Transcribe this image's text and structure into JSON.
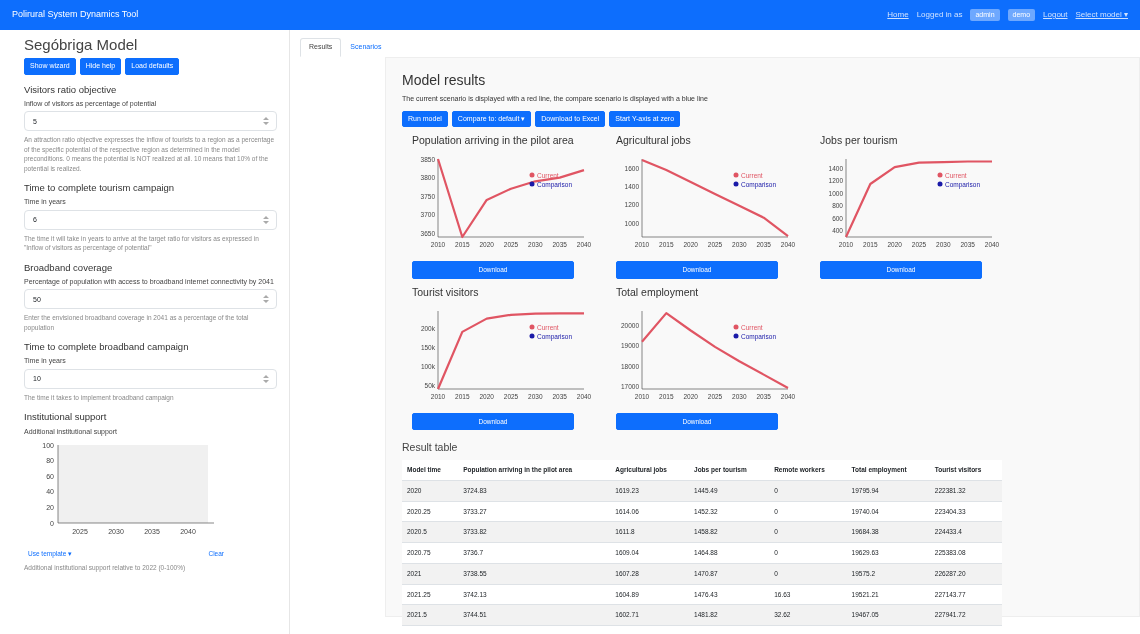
{
  "navbar": {
    "brand": "Polirural System Dynamics Tool",
    "links": [
      {
        "kind": "link",
        "label": "Home"
      },
      {
        "kind": "text",
        "label": "Logged in as"
      },
      {
        "kind": "badge",
        "label": "admin"
      },
      {
        "kind": "badge",
        "label": "demo"
      },
      {
        "kind": "link",
        "label": "Logout"
      },
      {
        "kind": "link",
        "label": "Select model ▾"
      }
    ]
  },
  "sidebar": {
    "title": "Segóbriga Model",
    "buttons": [
      "Show wizard",
      "Hide help",
      "Load defaults"
    ],
    "parameters": [
      {
        "kind": "input",
        "title": "Visitors ratio objective",
        "label": "Inflow of visitors as percentage of potential",
        "value": "5",
        "help": "An attraction ratio objective expresses the inflow of tourists to a region as a percentage of the specific potential of the respective region as determined in the model preconditions. 0 means the potential is NOT realized at all. 10 means that 10% of the potential is realized."
      },
      {
        "kind": "input",
        "title": "Time to complete tourism campaign",
        "label": "Time in years",
        "value": "6",
        "help": "The time it will take in years to arrive at the target ratio for visitors as expressed in \"Inflow of visitors as percentage of potential\""
      },
      {
        "kind": "input",
        "title": "Broadband coverage",
        "label": "Percentage of population with access to broadband internet connectivity by 2041",
        "value": "50",
        "help": "Enter the envisioned broadband coverage in 2041 as a percentage of the total population"
      },
      {
        "kind": "input",
        "title": "Time to complete broadband campaign",
        "label": "Time in years",
        "value": "10",
        "help": "The time it takes to implement broadband campaign"
      },
      {
        "kind": "graph",
        "title": "Institutional support",
        "label": "Additional institutional support",
        "y_ticks": [
          "100",
          "80",
          "60",
          "40",
          "20",
          "0"
        ],
        "x_ticks": [
          "2025",
          "2030",
          "2035",
          "2040"
        ],
        "template_link": "Use template ▾",
        "clear_link": "Clear",
        "help": "Additional institutional support relative to 2022 (0-100%)"
      }
    ]
  },
  "tabs": [
    {
      "label": "Results",
      "selected": true
    },
    {
      "label": "Scenarios",
      "selected": false
    }
  ],
  "results": {
    "title": "Model results",
    "description": "The current scenario is displayed with a red line, the compare scenario is displayed with a blue line",
    "buttons": [
      "Run model",
      "Compare to: default ▾",
      "Download to Excel",
      "Start Y-axis at zero"
    ],
    "charts": [
      {
        "download": "Download",
        "chart_data": {
          "type": "line",
          "title": "Population arriving in the pilot area",
          "x": [
            2010,
            2015,
            2020,
            2025,
            2030,
            2035,
            2040
          ],
          "xticks": [
            2010,
            2015,
            2020,
            2025,
            2030,
            2035,
            2040
          ],
          "xlim": [
            2010,
            2040
          ],
          "yticks": [
            3650,
            3700,
            3750,
            3800,
            3850
          ],
          "ylim": [
            3640,
            3850
          ],
          "series": [
            {
              "name": "Current",
              "color": "#e05563",
              "values": [
                3850,
                3640,
                3740,
                3770,
                3790,
                3800,
                3820
              ]
            },
            {
              "name": "Comparison",
              "color": "#1a1aa8",
              "values": [
                null,
                null,
                null,
                null,
                null,
                null,
                null
              ]
            }
          ]
        }
      },
      {
        "download": "Download",
        "chart_data": {
          "type": "line",
          "title": "Agricultural jobs",
          "x": [
            2010,
            2015,
            2020,
            2025,
            2030,
            2035,
            2040
          ],
          "xticks": [
            2010,
            2015,
            2020,
            2025,
            2030,
            2035,
            2040
          ],
          "xlim": [
            2010,
            2040
          ],
          "yticks": [
            1000,
            1200,
            1400,
            1600
          ],
          "ylim": [
            850,
            1700
          ],
          "series": [
            {
              "name": "Current",
              "color": "#e05563",
              "values": [
                1690,
                1580,
                1450,
                1320,
                1190,
                1060,
                860
              ]
            },
            {
              "name": "Comparison",
              "color": "#1a1aa8",
              "values": [
                null,
                null,
                null,
                null,
                null,
                null,
                null
              ]
            }
          ]
        }
      },
      {
        "download": "Download",
        "chart_data": {
          "type": "line",
          "title": "Jobs per tourism",
          "x": [
            2010,
            2015,
            2020,
            2025,
            2030,
            2035,
            2040
          ],
          "xticks": [
            2010,
            2015,
            2020,
            2025,
            2030,
            2035,
            2040
          ],
          "xlim": [
            2010,
            2040
          ],
          "yticks": [
            400,
            600,
            800,
            1000,
            1200,
            1400
          ],
          "ylim": [
            300,
            1550
          ],
          "series": [
            {
              "name": "Current",
              "color": "#e05563",
              "values": [
                300,
                1150,
                1420,
                1490,
                1500,
                1510,
                1510
              ]
            },
            {
              "name": "Comparison",
              "color": "#1a1aa8",
              "values": [
                null,
                null,
                null,
                null,
                null,
                null,
                null
              ]
            }
          ]
        }
      },
      {
        "download": "Download",
        "chart_data": {
          "type": "line",
          "title": "Tourist visitors",
          "x": [
            2010,
            2015,
            2020,
            2025,
            2030,
            2035,
            2040
          ],
          "xticks": [
            2010,
            2015,
            2020,
            2025,
            2030,
            2035,
            2040
          ],
          "yticks": [
            {
              "value": 50000,
              "label": "50k"
            },
            {
              "value": 100000,
              "label": "100k"
            },
            {
              "value": 150000,
              "label": "150k"
            },
            {
              "value": 200000,
              "label": "200k"
            }
          ],
          "xlim": [
            2010,
            2040
          ],
          "ylim": [
            40000,
            245000
          ],
          "series": [
            {
              "name": "Current",
              "color": "#e05563",
              "values": [
                40000,
                190000,
                225000,
                235000,
                238000,
                239000,
                239000
              ]
            },
            {
              "name": "Comparison",
              "color": "#1a1aa8",
              "values": [
                null,
                null,
                null,
                null,
                null,
                null,
                null
              ]
            }
          ]
        }
      },
      {
        "download": "Download",
        "chart_data": {
          "type": "line",
          "title": "Total employment",
          "x": [
            2010,
            2015,
            2020,
            2025,
            2030,
            2035,
            2040
          ],
          "xticks": [
            2010,
            2015,
            2020,
            2025,
            2030,
            2035,
            2040
          ],
          "xlim": [
            2010,
            2040
          ],
          "yticks": [
            17000,
            18000,
            19000,
            20000
          ],
          "ylim": [
            16900,
            20700
          ],
          "series": [
            {
              "name": "Current",
              "color": "#e05563",
              "values": [
                19200,
                20600,
                19750,
                18950,
                18250,
                17600,
                16950
              ]
            },
            {
              "name": "Comparison",
              "color": "#1a1aa8",
              "values": [
                null,
                null,
                null,
                null,
                null,
                null,
                null
              ]
            }
          ]
        }
      }
    ],
    "table": {
      "title": "Result table",
      "columns": [
        "Model time",
        "Population arriving in the pilot area",
        "Agricultural jobs",
        "Jobs per tourism",
        "Remote workers",
        "Total employment",
        "Tourist visitors"
      ],
      "rows": [
        [
          "2020",
          "3724.83",
          "1619.23",
          "1445.49",
          "0",
          "19795.94",
          "222381.32"
        ],
        [
          "2020.25",
          "3733.27",
          "1614.06",
          "1452.32",
          "0",
          "19740.04",
          "223404.33"
        ],
        [
          "2020.5",
          "3733.82",
          "1611.8",
          "1458.82",
          "0",
          "19684.38",
          "224433.4"
        ],
        [
          "2020.75",
          "3736.7",
          "1609.04",
          "1464.88",
          "0",
          "19629.63",
          "225383.08"
        ],
        [
          "2021",
          "3738.55",
          "1607.28",
          "1470.87",
          "0",
          "19575.2",
          "226287.20"
        ],
        [
          "2021.25",
          "3742.13",
          "1604.89",
          "1476.43",
          "16.63",
          "19521.21",
          "227143.77"
        ],
        [
          "2021.5",
          "3744.51",
          "1602.71",
          "1481.82",
          "32.62",
          "19467.05",
          "227941.72"
        ]
      ]
    }
  }
}
